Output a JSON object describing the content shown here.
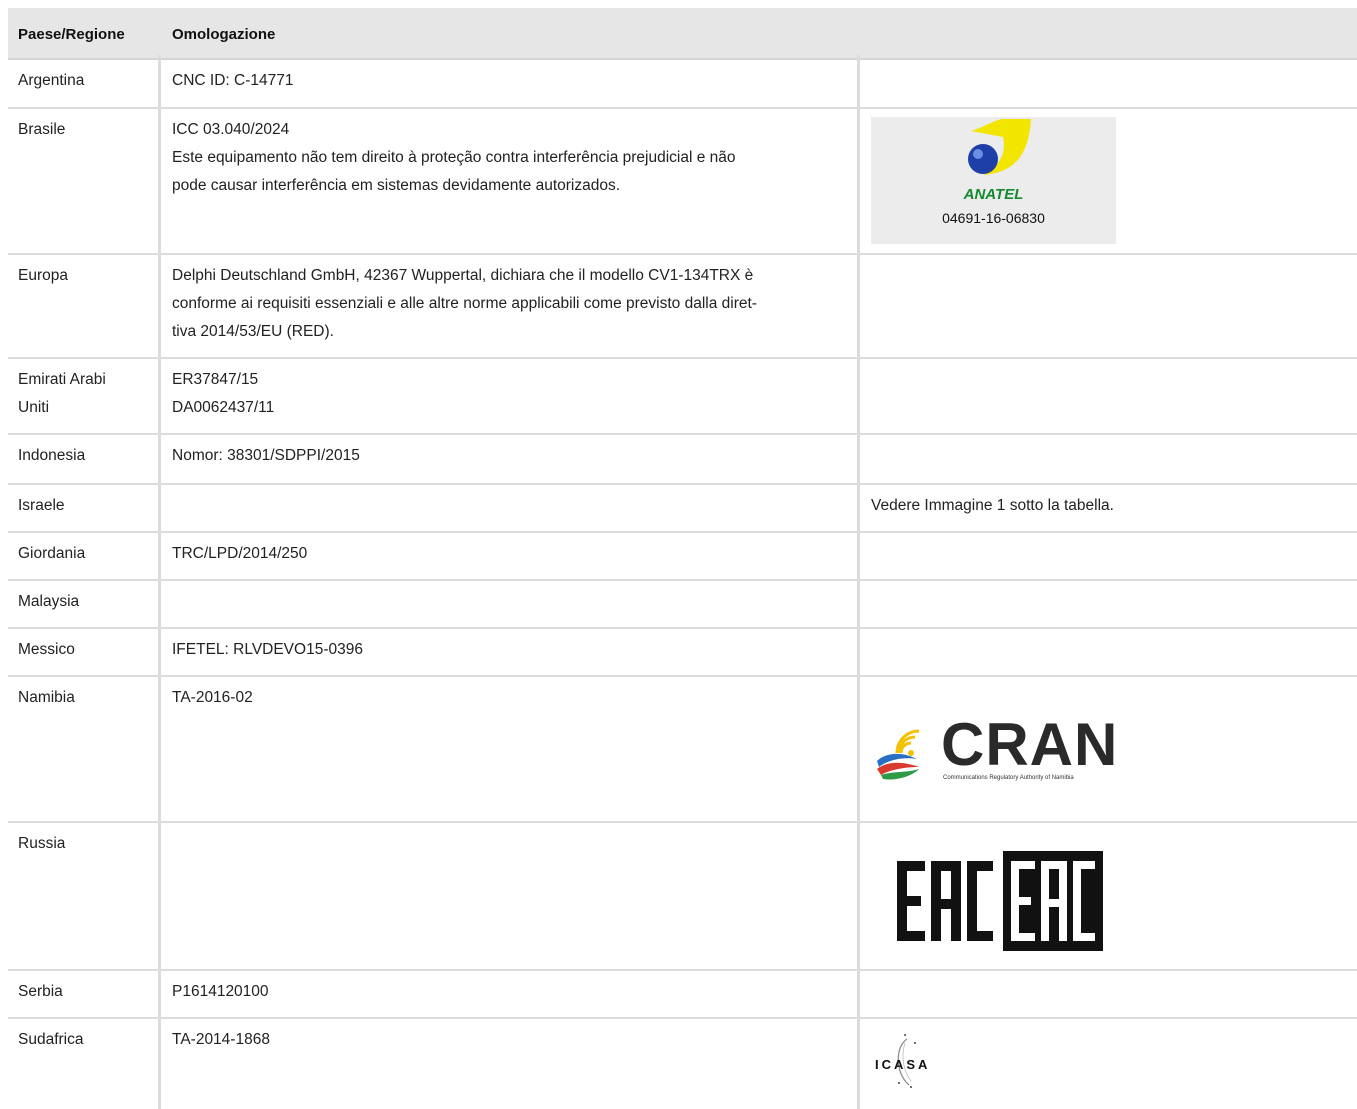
{
  "header": {
    "col1": "Paese/Regione",
    "col2": "Omologazione"
  },
  "rows": [
    {
      "country": "Argentina",
      "approval": [
        "CNC ID: C-14771"
      ],
      "note": ""
    },
    {
      "country": "Brasile",
      "approval": [
        "ICC 03.040/2024",
        "Este equipamento não tem direito à proteção contra interferência prejudicial e não",
        "pode causar interferência em sistemas devidamente autorizados."
      ],
      "note": ""
    },
    {
      "country": "Europa",
      "approval": [
        "Delphi Deutschland GmbH, 42367 Wuppertal, dichiara che il modello CV1-134TRX è",
        "conforme ai requisiti essenziali e alle altre norme applicabili come previsto dalla diret-",
        "tiva 2014/53/EU (RED)."
      ],
      "note": ""
    },
    {
      "country": [
        "Emirati Arabi",
        "Uniti"
      ],
      "approval": [
        "ER37847/15",
        "DA0062437/11"
      ],
      "note": ""
    },
    {
      "country": "Indonesia",
      "approval": [
        "Nomor: 38301/SDPPI/2015"
      ],
      "note": ""
    },
    {
      "country": "Israele",
      "approval": [],
      "note": "Vedere Immagine 1 sotto la tabella."
    },
    {
      "country": "Giordania",
      "approval": [
        "TRC/LPD/2014/250"
      ],
      "note": ""
    },
    {
      "country": "Malaysia",
      "approval": [],
      "note": ""
    },
    {
      "country": "Messico",
      "approval": [
        "IFETEL: RLVDEVO15-0396"
      ],
      "note": ""
    },
    {
      "country": "Namibia",
      "approval": [
        "TA-2016-02"
      ],
      "note": ""
    },
    {
      "country": "Russia",
      "approval": [],
      "note": ""
    },
    {
      "country": "Serbia",
      "approval": [
        "P1614120100"
      ],
      "note": ""
    },
    {
      "country": "Sudafrica",
      "approval": [
        "TA-2014-1868"
      ],
      "note": ""
    }
  ],
  "logos": {
    "anatel": {
      "word": "ANATEL",
      "number": "04691-16-06830",
      "color_ball": "#1f3fa8",
      "color_arc": "#f2e600",
      "color_text": "#138a2f"
    },
    "cran": {
      "word": "CRAN",
      "subtitle": "Communications Regulatory Authority of Namibia"
    },
    "eac": {
      "word": "EAC"
    },
    "icasa": {
      "word": "ICASA"
    }
  }
}
